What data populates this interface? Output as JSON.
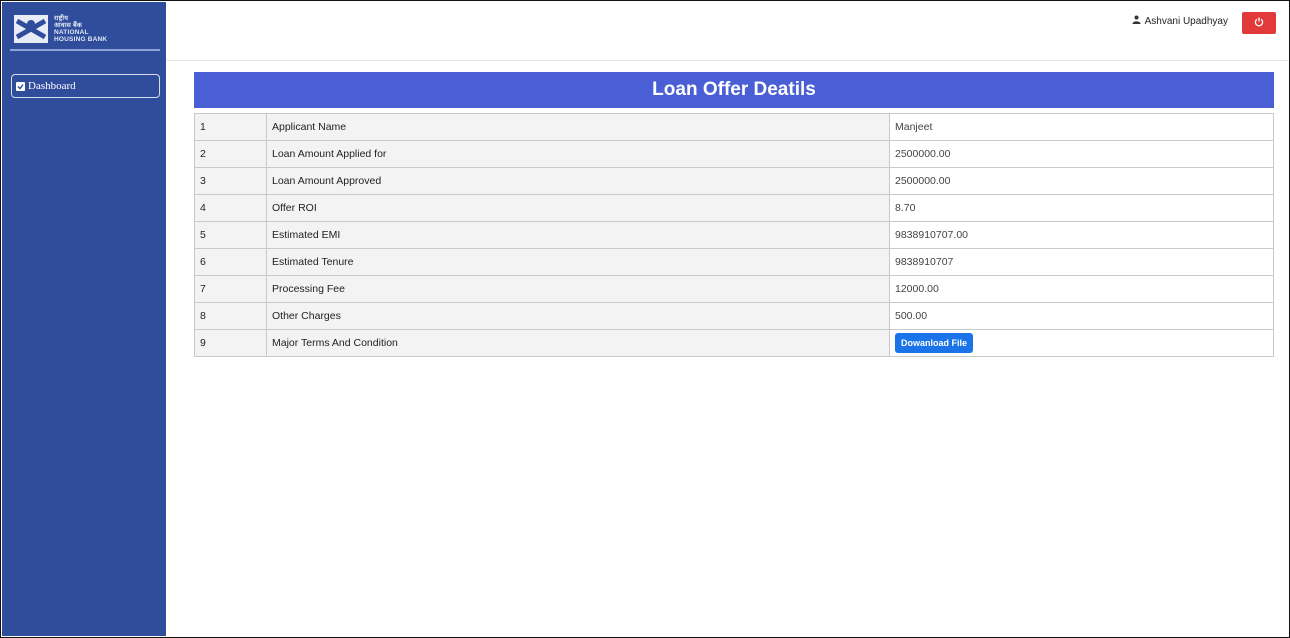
{
  "logo": {
    "line1": "राष्ट्रीय",
    "line2": "आवास बैंक",
    "line3": "NATIONAL",
    "line4": "HOUSING BANK"
  },
  "sidebar": {
    "items": [
      {
        "label": "Dashboard",
        "icon": "checkbox-icon"
      }
    ]
  },
  "header": {
    "user_name": "Ashvani Upadhyay",
    "user_icon": "user-icon",
    "power_icon": "power-icon"
  },
  "main": {
    "title": "Loan Offer Deatils",
    "rows": [
      {
        "num": "1",
        "label": "Applicant Name",
        "value": "Manjeet"
      },
      {
        "num": "2",
        "label": "Loan Amount Applied for",
        "value": "2500000.00"
      },
      {
        "num": "3",
        "label": "Loan Amount Approved",
        "value": "2500000.00"
      },
      {
        "num": "4",
        "label": "Offer ROI",
        "value": "8.70"
      },
      {
        "num": "5",
        "label": "Estimated EMI",
        "value": "9838910707.00"
      },
      {
        "num": "6",
        "label": "Estimated Tenure",
        "value": "9838910707"
      },
      {
        "num": "7",
        "label": "Processing Fee",
        "value": "12000.00"
      },
      {
        "num": "8",
        "label": "Other Charges",
        "value": "500.00"
      },
      {
        "num": "9",
        "label": "Major Terms And Condition",
        "button_label": "Dowanload File"
      }
    ]
  },
  "colors": {
    "sidebar": "#2f4d9b",
    "title_bar": "#4a5fd6",
    "button": "#1a73e8",
    "power": "#e23a3a"
  }
}
